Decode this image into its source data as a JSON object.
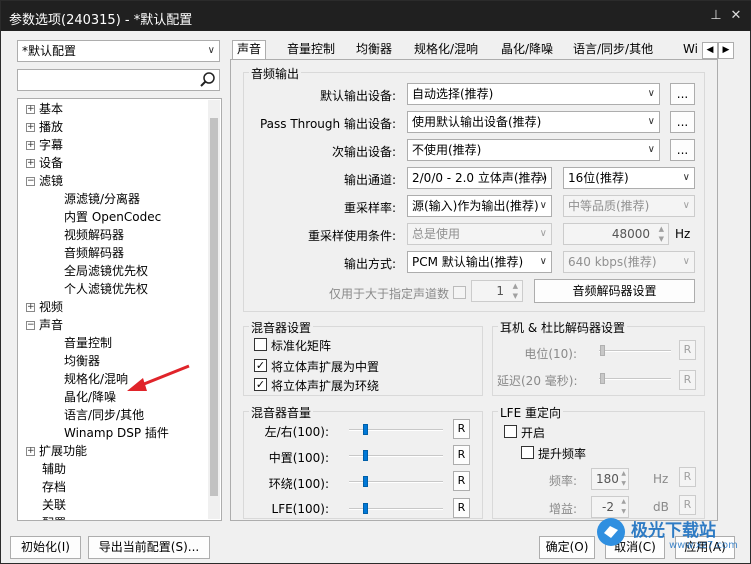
{
  "window": {
    "title": "参数选项(240315) - *默认配置"
  },
  "profile_select": {
    "value": "*默认配置"
  },
  "tree": {
    "items": [
      {
        "label": "基本",
        "expander": "+"
      },
      {
        "label": "播放",
        "expander": "+"
      },
      {
        "label": "字幕",
        "expander": "+"
      },
      {
        "label": "设备",
        "expander": "+"
      },
      {
        "label": "滤镜",
        "expander": "-"
      },
      {
        "label": "源滤镜/分离器"
      },
      {
        "label": "内置 OpenCodec"
      },
      {
        "label": "视频解码器"
      },
      {
        "label": "音频解码器"
      },
      {
        "label": "全局滤镜优先权"
      },
      {
        "label": "个人滤镜优先权"
      },
      {
        "label": "视频",
        "expander": "+"
      },
      {
        "label": "声音",
        "expander": "-"
      },
      {
        "label": "音量控制"
      },
      {
        "label": "均衡器"
      },
      {
        "label": "规格化/混响"
      },
      {
        "label": "晶化/降噪"
      },
      {
        "label": "语言/同步/其他"
      },
      {
        "label": "Winamp DSP 插件"
      },
      {
        "label": "扩展功能",
        "expander": "+"
      },
      {
        "label": "辅助"
      },
      {
        "label": "存档"
      },
      {
        "label": "关联"
      },
      {
        "label": "配置"
      }
    ]
  },
  "tabs": [
    "声音",
    "音量控制",
    "均衡器",
    "规格化/混响",
    "晶化/降噪",
    "语言/同步/其他",
    "Wi"
  ],
  "audio_output": {
    "title": "音频输出",
    "default_device_label": "默认输出设备:",
    "default_device_value": "自动选择(推荐)",
    "passthrough_label": "Pass Through 输出设备:",
    "passthrough_value": "使用默认输出设备(推荐)",
    "secondary_label": "次输出设备:",
    "secondary_value": "不使用(推荐)",
    "ellipsis": "...",
    "channel_label": "输出通道:",
    "channel_value": "2/0/0 - 2.0 立体声(推荐)",
    "bits_value": "16位(推荐)",
    "resample_label": "重采样率:",
    "resample_value": "源(输入)作为输出(推荐)",
    "resample_quality": "中等品质(推荐)",
    "resample_cond_label": "重采样使用条件:",
    "resample_cond_value": "总是使用",
    "hz_value": "48000",
    "hz_unit": "Hz",
    "output_mode_label": "输出方式:",
    "output_mode_value": "PCM 默认输出(推荐)",
    "bitrate_value": "640 kbps(推荐)",
    "only_channels_label": "仅用于大于指定声道数",
    "only_channels_value": "1",
    "decoder_settings_button": "音频解码器设置"
  },
  "mixer": {
    "title": "混音器设置",
    "standard_matrix": "标准化矩阵",
    "stereo_to_center": "将立体声扩展为中置",
    "stereo_to_surround": "将立体声扩展为环绕",
    "standard_matrix_checked": false,
    "stereo_to_center_checked": true,
    "stereo_to_surround_checked": true
  },
  "headphone": {
    "title": "耳机 & 杜比解码器设置",
    "level_label": "电位(10):",
    "delay_label": "延迟(20 毫秒):",
    "level_value": 0,
    "delay_value": 0
  },
  "mixer_volume": {
    "title": "混音器音量",
    "rows": [
      {
        "label": "左/右(100):",
        "value": 100
      },
      {
        "label": "中置(100):",
        "value": 100
      },
      {
        "label": "环绕(100):",
        "value": 100
      },
      {
        "label": "LFE(100):",
        "value": 100
      }
    ],
    "reset": "R"
  },
  "lfe": {
    "title": "LFE 重定向",
    "enable_label": "开启",
    "boost_label": "提升频率",
    "freq_label": "频率:",
    "freq_value": "180",
    "freq_unit": "Hz",
    "gain_label": "增益:",
    "gain_value": "-2",
    "gain_unit": "dB"
  },
  "footer": {
    "init_button": "初始化(I)",
    "export_button": "导出当前配置(S)...",
    "ok_button": "确定(O)",
    "cancel_button": "取消(C)",
    "apply_button": "应用(A)"
  },
  "watermark": {
    "text": "极光下载站",
    "url": "www.xz7.com"
  },
  "colors": {
    "accent": "#0078d7",
    "arrow": "#e0242a",
    "titlebar": "#202020"
  }
}
